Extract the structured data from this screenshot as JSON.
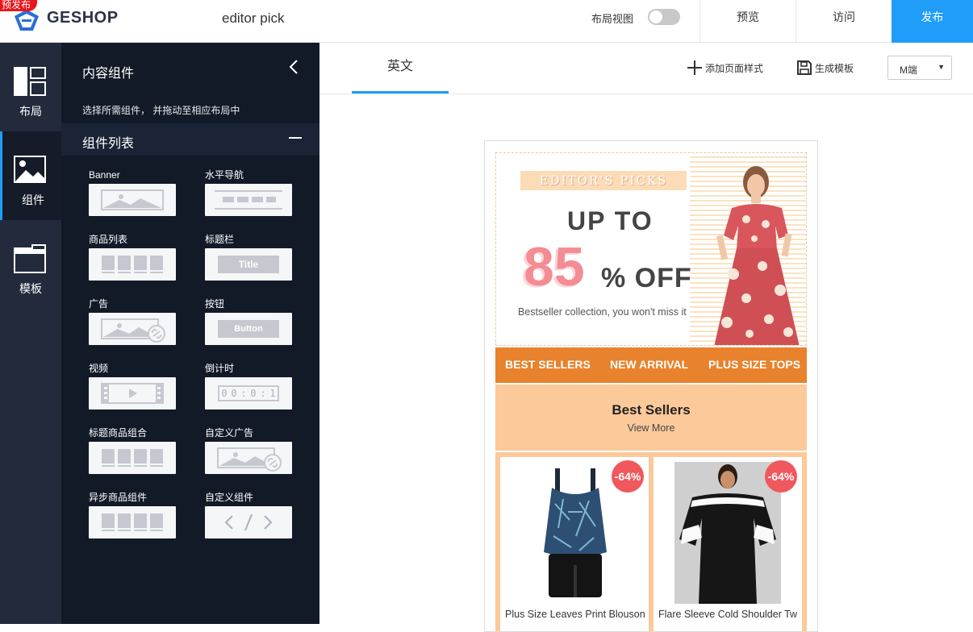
{
  "header": {
    "badge": "预发布",
    "brand": "GESHOP",
    "page_name": "editor pick",
    "layout_view_label": "布局视图",
    "preview_label": "预览",
    "visit_label": "访问",
    "publish_label": "发布"
  },
  "rail": {
    "items": [
      {
        "label": "布局",
        "icon": "layout-icon"
      },
      {
        "label": "组件",
        "icon": "image-icon"
      },
      {
        "label": "模板",
        "icon": "template-icon"
      }
    ]
  },
  "panel": {
    "title": "内容组件",
    "hint": "选择所需组件， 并拖动至相应布局中",
    "list_title": "组件列表",
    "components": [
      {
        "label": "Banner"
      },
      {
        "label": "水平导航"
      },
      {
        "label": "商品列表"
      },
      {
        "label": "标题栏",
        "thumb_text": "Title"
      },
      {
        "label": "广告"
      },
      {
        "label": "按钮",
        "thumb_text": "Button"
      },
      {
        "label": "视频"
      },
      {
        "label": "倒计时",
        "digits": [
          "0",
          "0",
          "0",
          "1"
        ]
      },
      {
        "label": "标题商品组合"
      },
      {
        "label": "自定义广告"
      },
      {
        "label": "异步商品组件"
      },
      {
        "label": "自定义组件"
      }
    ]
  },
  "canvas": {
    "tab": "英文",
    "add_style": "添加页面样式",
    "gen_template": "生成模板",
    "device_select": "M端"
  },
  "preview": {
    "banner": {
      "tag": "EDITOR'S PICKS",
      "up_to": "UP TO",
      "number": "85",
      "off": "% OFF",
      "sub": "Bestseller collection, you won't miss it"
    },
    "nav": [
      "BEST SELLERS",
      "NEW ARRIVAL",
      "PLUS SIZE TOPS"
    ],
    "section": {
      "title": "Best Sellers",
      "more": "View More"
    },
    "goods": [
      {
        "discount": "-64%",
        "name": "Plus Size Leaves Print Blouson"
      },
      {
        "discount": "-64%",
        "name": "Flare Sleeve Cold Shoulder Tw"
      }
    ]
  },
  "colors": {
    "accent": "#1f9df9",
    "rail_bg": "#222a3c",
    "panel_bg": "#121a28",
    "nav_orange": "#e8822d",
    "section_peach": "#fcc99a",
    "discount_red": "#f0585e"
  }
}
